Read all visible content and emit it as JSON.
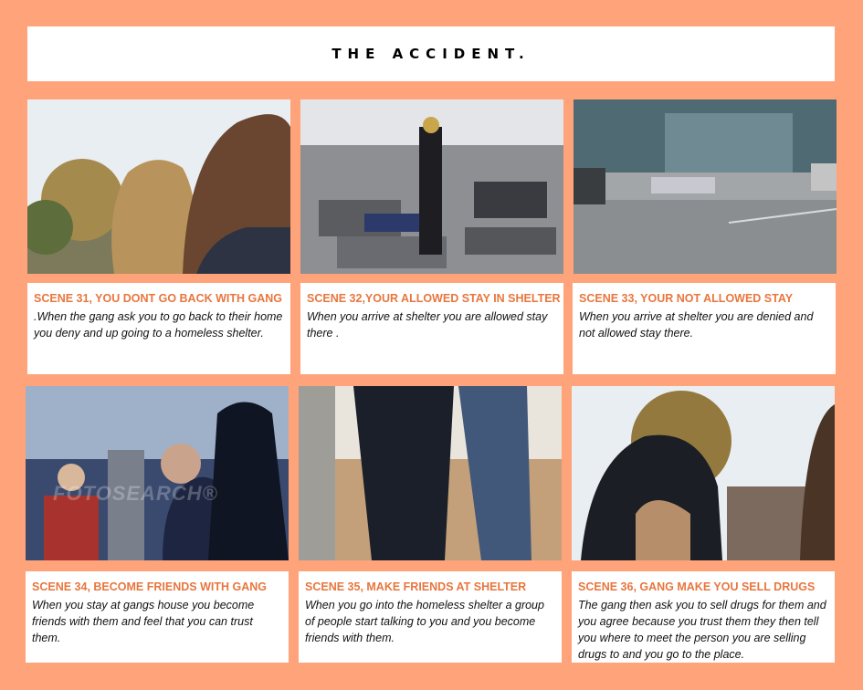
{
  "title": "THE ACCIDENT.",
  "scenes": [
    {
      "heading": "SCENE 31, YOU DONT GO BACK WITH GANG",
      "text": ".When the gang ask you to go back to their home you deny and up going to a homeless shelter."
    },
    {
      "heading": "SCENE 32,YOUR ALLOWED STAY IN SHELTER",
      "text": "When you arrive at shelter you are allowed stay there ."
    },
    {
      "heading": "SCENE 33, YOUR NOT ALLOWED STAY",
      "text": "When you arrive at shelter you are denied and not allowed stay there."
    },
    {
      "heading": "SCENE 34, BECOME FRIENDS WITH GANG",
      "text": "When you stay at gangs house you become friends with them and feel that you can trust them."
    },
    {
      "heading": "SCENE 35, MAKE FRIENDS AT SHELTER",
      "text": "When you go into the homeless shelter a group of people start talking to you and you become friends with them."
    },
    {
      "heading": "SCENE 36, GANG MAKE YOU SELL DRUGS",
      "text": "The gang then ask you to sell drugs for them and you agree because you trust them they then tell you where to meet the person you are selling drugs to and you go to the place."
    }
  ],
  "watermark": "FOTOSEARCH®"
}
